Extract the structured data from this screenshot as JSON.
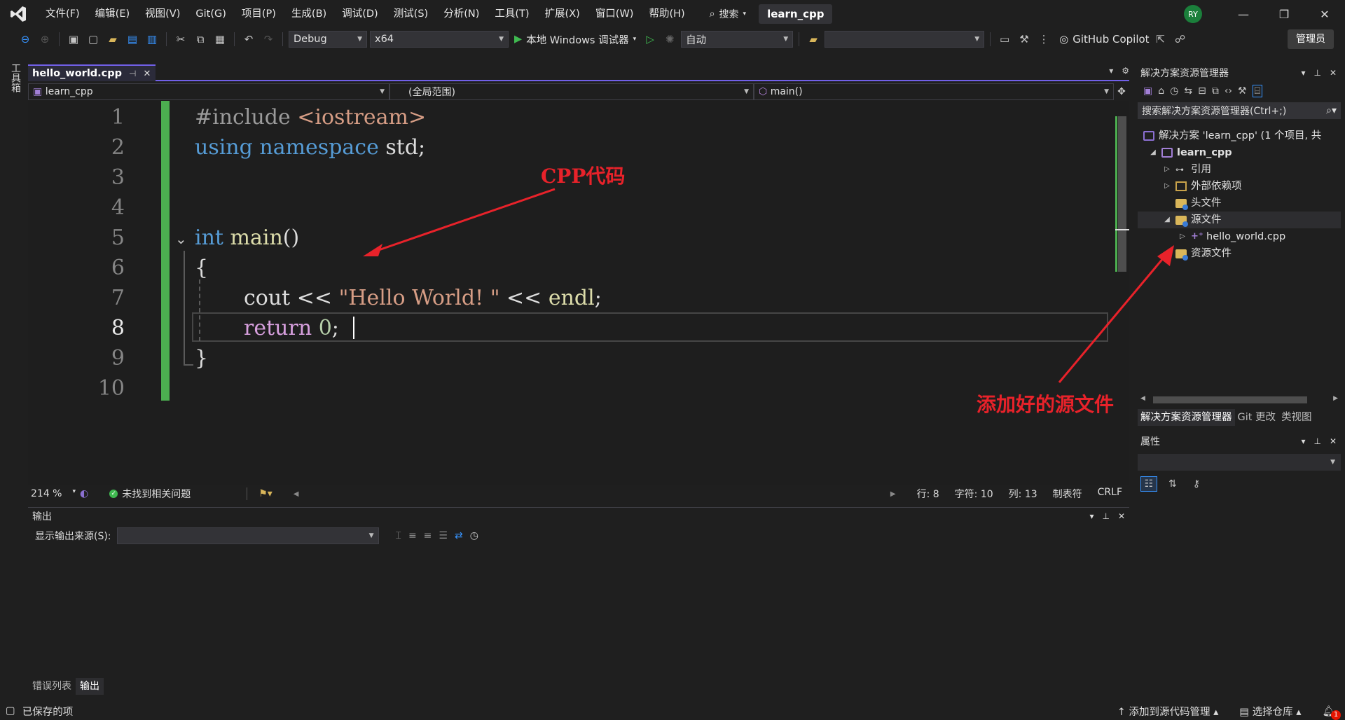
{
  "menu": {
    "items": [
      "文件(F)",
      "编辑(E)",
      "视图(V)",
      "Git(G)",
      "项目(P)",
      "生成(B)",
      "调试(D)",
      "测试(S)",
      "分析(N)",
      "工具(T)",
      "扩展(X)",
      "窗口(W)",
      "帮助(H)"
    ],
    "search_label": "搜索",
    "project_title": "learn_cpp",
    "avatar_initials": "RY"
  },
  "toolbar": {
    "config": "Debug",
    "platform": "x64",
    "run_label": "本地 Windows 调试器",
    "solution_config": "自动",
    "copilot": "GitHub Copilot",
    "admin": "管理员"
  },
  "toolbox_label": "工具箱",
  "editor": {
    "tab_name": "hello_world.cpp",
    "nav_project": "learn_cpp",
    "nav_scope": "(全局范围)",
    "nav_member": "main()",
    "lines": [
      "1",
      "2",
      "3",
      "4",
      "5",
      "6",
      "7",
      "8",
      "9",
      "10"
    ],
    "current_line": 8,
    "code": {
      "l1_pp": "#include ",
      "l1_inc": "<iostream>",
      "l2_kw1": "using",
      "l2_kw2": "namespace",
      "l2_rest": " std;",
      "l5_kw": "int",
      "l5_fn": "main",
      "l5_rest": "()",
      "l6": "{",
      "l7_a": "cout << ",
      "l7_str": "\"Hello World! \"",
      "l7_b": " << ",
      "l7_fn": "endl",
      "l7_c": ";",
      "l8_kw": "return",
      "l8_num": "0",
      "l8_c": ";",
      "l9": "}"
    },
    "annotation_code": "CPP代码",
    "annotation_file": "添加好的源文件"
  },
  "editor_status": {
    "zoom": "214 %",
    "issues": "未找到相关问题",
    "row": "行: 8",
    "char": "字符: 10",
    "col": "列: 13",
    "tabs": "制表符",
    "eol": "CRLF"
  },
  "output": {
    "title": "输出",
    "source_label": "显示输出来源(S):",
    "source_value": ""
  },
  "bottom_tabs": [
    "错误列表",
    "输出"
  ],
  "solution_explorer": {
    "title": "解决方案资源管理器",
    "search_placeholder": "搜索解决方案资源管理器(Ctrl+;)",
    "tree": {
      "solution": "解决方案 'learn_cpp' (1 个项目, 共",
      "project": "learn_cpp",
      "references": "引用",
      "external": "外部依赖项",
      "headers": "头文件",
      "sources": "源文件",
      "source_file": "hello_world.cpp",
      "resources": "资源文件"
    },
    "tabs": [
      "解决方案资源管理器",
      "Git 更改",
      "类视图"
    ]
  },
  "properties": {
    "title": "属性"
  },
  "statusbar": {
    "saved": "已保存的项",
    "add_scm": "添加到源代码管理",
    "select_repo": "选择仓库",
    "notif_count": "1"
  }
}
